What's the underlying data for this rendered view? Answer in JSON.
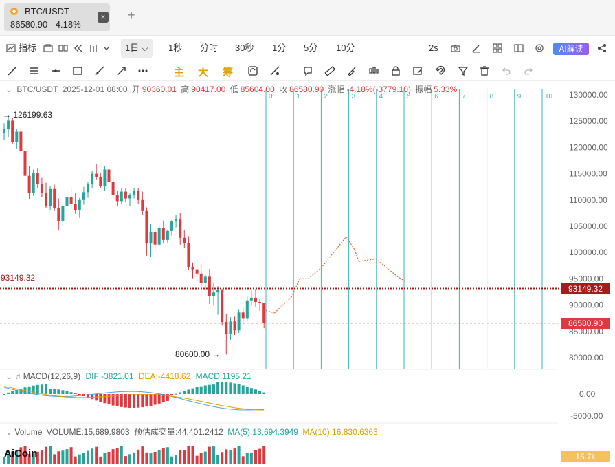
{
  "tab": {
    "symbol": "BTC/USDT",
    "price": "86580.90",
    "change": "-4.18%",
    "close": "×",
    "add": "+"
  },
  "toolbar1": {
    "indicators": "指标",
    "timeframe_active": "1日",
    "timeframes": [
      "1秒",
      "分时",
      "30秒",
      "1分",
      "5分",
      "10分"
    ],
    "interval_right": "2s",
    "ai_label": "AI解读"
  },
  "toolbar2": {
    "kanji": [
      "主",
      "大",
      "筹"
    ]
  },
  "ohlc": {
    "symbol": "BTC/USDT",
    "date": "2025-12-01 08:00",
    "open_label": "开",
    "open": "90360.01",
    "high_label": "高",
    "high": "90417.00",
    "low_label": "低",
    "low": "85604.00",
    "close_label": "收",
    "close": "86580.90",
    "change_label": "涨幅",
    "change": "-4.18%(-3779.10)",
    "amp_label": "振幅",
    "amp": "5.33%"
  },
  "price_axis": [
    "130000.00",
    "125000.00",
    "120000.00",
    "115000.00",
    "110000.00",
    "105000.00",
    "100000.00",
    "95000.00",
    "90000.00",
    "85000.00",
    "80000.00"
  ],
  "annotations": {
    "high": "126199.63",
    "low": "80600.00",
    "level_left": "93149.32",
    "level_tag": "93149.32",
    "last_tag": "86580.90"
  },
  "fib_labels": [
    "0",
    "1",
    "2",
    "3",
    "4",
    "5",
    "6",
    "7",
    "8",
    "9",
    "10"
  ],
  "macd": {
    "title": "MACD(12,26,9)",
    "dif": "DIF:-3821.01",
    "dea": "DEA:-4418.62",
    "macd": "MACD:1195.21",
    "axis": [
      "0.00",
      "-5000.00"
    ]
  },
  "volume": {
    "title": "Volume",
    "value": "VOLUME:15,689.9803",
    "est": "预估成交量:44,401.2412",
    "ma5": "MA(5):13,694.3949",
    "ma10": "MA(10):16,830.6363",
    "tag": "15.7k"
  },
  "logo": "AiCoin",
  "colors": {
    "up": "#26a69a",
    "down": "#e0383e",
    "fib": "#3cb4b4",
    "level": "#a31d1d",
    "arrow": "#e06a2c"
  },
  "chart_data": {
    "type": "candlestick",
    "candles": [
      [
        122800,
        124600,
        121400,
        123500
      ],
      [
        123500,
        126199.63,
        122000,
        125100
      ],
      [
        125100,
        125600,
        120600,
        121100
      ],
      [
        121100,
        123500,
        119800,
        123000
      ],
      [
        123000,
        123800,
        118700,
        119300
      ],
      [
        119300,
        121100,
        101600,
        114600
      ],
      [
        114600,
        116400,
        110200,
        111300
      ],
      [
        111300,
        115800,
        110800,
        115200
      ],
      [
        115200,
        116100,
        112300,
        113000
      ],
      [
        113000,
        114200,
        110600,
        111300
      ],
      [
        111300,
        113300,
        108500,
        108900
      ],
      [
        108900,
        112600,
        108000,
        112100
      ],
      [
        112100,
        112900,
        107900,
        108400
      ],
      [
        108400,
        110300,
        104200,
        106000
      ],
      [
        106000,
        109400,
        105100,
        108900
      ],
      [
        108900,
        111100,
        107600,
        110500
      ],
      [
        110500,
        112100,
        108700,
        109300
      ],
      [
        109300,
        111300,
        107400,
        108100
      ],
      [
        108100,
        110400,
        106600,
        110000
      ],
      [
        110000,
        112500,
        109100,
        111500
      ],
      [
        111500,
        113500,
        110400,
        113000
      ],
      [
        113000,
        115600,
        112200,
        115000
      ],
      [
        115000,
        116800,
        113800,
        114300
      ],
      [
        114300,
        115100,
        112300,
        112700
      ],
      [
        112700,
        116400,
        111800,
        115800
      ],
      [
        115800,
        116300,
        112700,
        113500
      ],
      [
        113500,
        114800,
        110400,
        110900
      ],
      [
        110900,
        111700,
        108800,
        109800
      ],
      [
        109800,
        112200,
        109300,
        111600
      ],
      [
        111600,
        112300,
        109700,
        110300
      ],
      [
        110300,
        111300,
        108900,
        110900
      ],
      [
        110900,
        112300,
        110300,
        111700
      ],
      [
        111700,
        112200,
        109300,
        110000
      ],
      [
        110000,
        111600,
        107200,
        107900
      ],
      [
        107900,
        108600,
        99400,
        101700
      ],
      [
        101700,
        105400,
        99200,
        103900
      ],
      [
        103900,
        104800,
        100300,
        101500
      ],
      [
        101500,
        105200,
        101200,
        104700
      ],
      [
        104700,
        106100,
        101800,
        102400
      ],
      [
        102400,
        104400,
        101900,
        104100
      ],
      [
        104100,
        106200,
        103200,
        105900
      ],
      [
        105900,
        107100,
        104800,
        106300
      ],
      [
        106300,
        107500,
        101500,
        102800
      ],
      [
        102800,
        104200,
        100800,
        101800
      ],
      [
        101800,
        103100,
        96700,
        97300
      ],
      [
        97300,
        98100,
        95100,
        96800
      ],
      [
        96800,
        97700,
        94700,
        96000
      ],
      [
        96000,
        97600,
        93500,
        94200
      ],
      [
        94200,
        95900,
        92800,
        95400
      ],
      [
        95400,
        96900,
        90200,
        91700
      ],
      [
        91700,
        94300,
        89900,
        92400
      ],
      [
        92400,
        93600,
        88200,
        92900
      ],
      [
        92900,
        93100,
        86100,
        86800
      ],
      [
        86800,
        88300,
        80600,
        84500
      ],
      [
        84500,
        87700,
        83300,
        86900
      ],
      [
        86900,
        87800,
        84300,
        85200
      ],
      [
        85200,
        89100,
        84700,
        88600
      ],
      [
        88600,
        89600,
        86300,
        87400
      ],
      [
        87400,
        91600,
        86900,
        90900
      ],
      [
        90900,
        92800,
        90000,
        91400
      ],
      [
        91400,
        93100,
        89700,
        90600
      ],
      [
        90600,
        91100,
        88900,
        90400
      ],
      [
        90360.01,
        90417,
        85604,
        86580.9
      ]
    ],
    "ylim": [
      77500,
      133000
    ],
    "levels": [
      93149.32,
      86580.9
    ],
    "projection": [
      [
        88500,
        1
      ],
      [
        91500,
        3
      ],
      [
        95000,
        4
      ],
      [
        95000,
        5
      ],
      [
        97000,
        6.5
      ],
      [
        101000,
        8.5
      ],
      [
        103000,
        9.5
      ],
      [
        100500,
        10.5
      ],
      [
        98300,
        11
      ],
      [
        98800,
        13
      ],
      [
        97500,
        14
      ],
      [
        95500,
        15.5
      ],
      [
        94500,
        16.5
      ]
    ]
  }
}
